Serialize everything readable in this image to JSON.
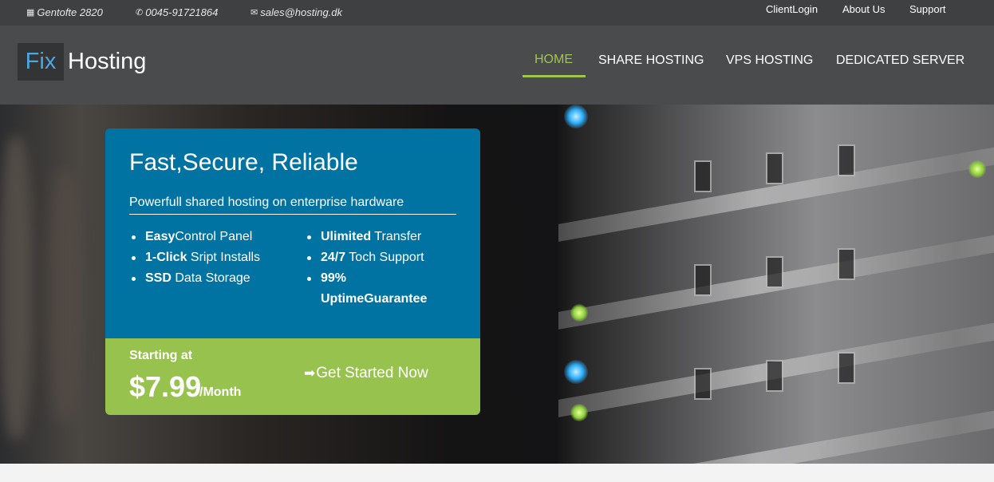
{
  "topbar": {
    "address": "Gentofte 2820",
    "phone": "0045-91721864",
    "email": "sales@hosting.dk",
    "links": [
      "ClientLogin",
      "About Us",
      "Support"
    ]
  },
  "logo": {
    "part1": "Fix",
    "part2": "Hosting"
  },
  "nav": [
    "HOME",
    "SHARE HOSTING",
    "VPS HOSTING",
    "DEDICATED SERVER"
  ],
  "hero": {
    "title": "Fast,Secure, Reliable",
    "subtitle": "Powerfull shared hosting on enterprise hardware",
    "features_left": [
      {
        "bold": "Easy",
        "rest": "Control Panel"
      },
      {
        "bold": "1-Click",
        "rest": " Sript Installs"
      },
      {
        "bold": "SSD",
        "rest": " Data Storage"
      }
    ],
    "features_right": [
      {
        "bold": "Ulimited",
        "rest": " Transfer"
      },
      {
        "bold": "24/7",
        "rest": " Toch Support"
      },
      {
        "bold": "99% UptimeGuarantee",
        "rest": ""
      }
    ],
    "starting_at": "Starting at",
    "price": "$7.99",
    "per": "/Month",
    "cta": "Get Started Now"
  },
  "colors": {
    "accent": "#9fc54d",
    "card_blue": "#0073a2",
    "card_green": "#97c24d",
    "logo_blue": "#4aa8e0"
  }
}
